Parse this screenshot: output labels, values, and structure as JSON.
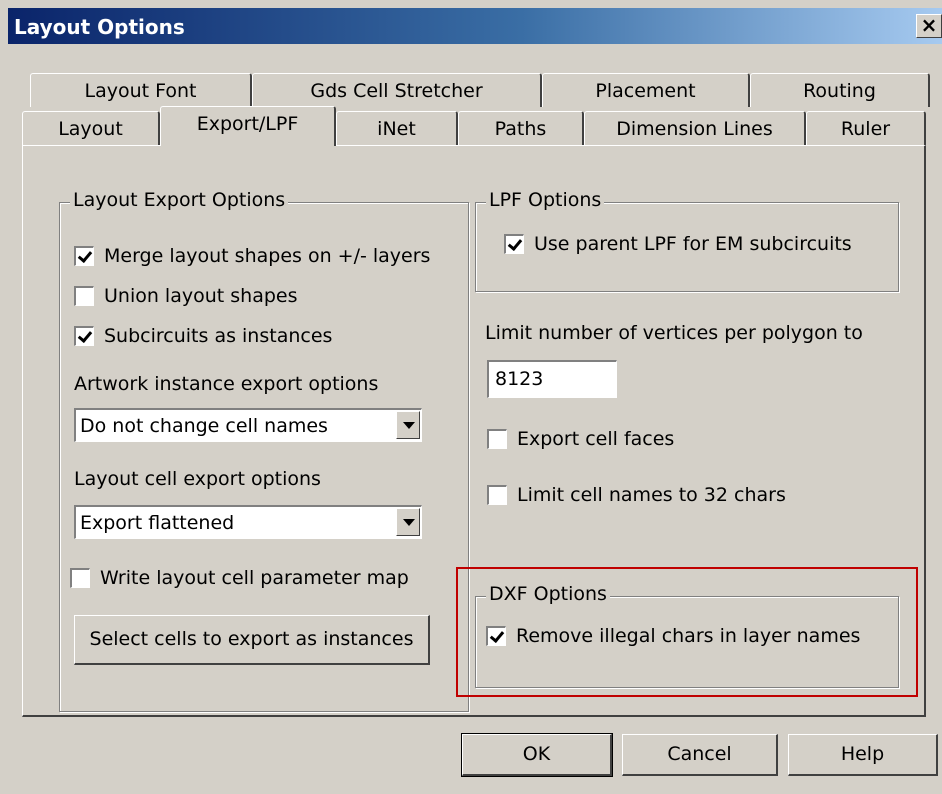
{
  "window": {
    "title": "Layout Options",
    "close_glyph": "×"
  },
  "tabs_row1": [
    {
      "label": "Layout Font"
    },
    {
      "label": "Gds Cell Stretcher"
    },
    {
      "label": "Placement"
    },
    {
      "label": "Routing"
    }
  ],
  "tabs_row2": [
    {
      "label": "Layout"
    },
    {
      "label": "Export/LPF",
      "active": true
    },
    {
      "label": "iNet"
    },
    {
      "label": "Paths"
    },
    {
      "label": "Dimension Lines"
    },
    {
      "label": "Ruler"
    }
  ],
  "layout_export": {
    "title": "Layout Export Options",
    "merge": {
      "label": "Merge layout shapes on +/- layers",
      "checked": true
    },
    "union": {
      "label": "Union layout shapes",
      "checked": false
    },
    "subcircuits": {
      "label": "Subcircuits as instances",
      "checked": true
    },
    "artwork_label": "Artwork instance export options",
    "artwork_value": "Do not change cell names",
    "cell_export_label": "Layout cell export options",
    "cell_export_value": "Export flattened",
    "write_map": {
      "label": "Write layout cell parameter map",
      "checked": false
    },
    "select_cells_button": "Select cells to export as instances"
  },
  "lpf": {
    "title": "LPF Options",
    "use_parent": {
      "label": "Use parent LPF for EM subcircuits",
      "checked": true
    }
  },
  "limit_vertices_label": "Limit number of vertices per polygon to",
  "limit_vertices_value": "8123",
  "export_faces": {
    "label": "Export cell faces",
    "checked": false
  },
  "limit_names": {
    "label": "Limit cell names to 32 chars",
    "checked": false
  },
  "dxf": {
    "title": "DXF Options",
    "remove_illegal": {
      "label": "Remove illegal chars in layer names",
      "checked": true
    }
  },
  "buttons": {
    "ok": "OK",
    "cancel": "Cancel",
    "help": "Help"
  },
  "colors": {
    "highlight": "#c00000",
    "face": "#d4d0c8",
    "title_bar": "#0a246a"
  }
}
